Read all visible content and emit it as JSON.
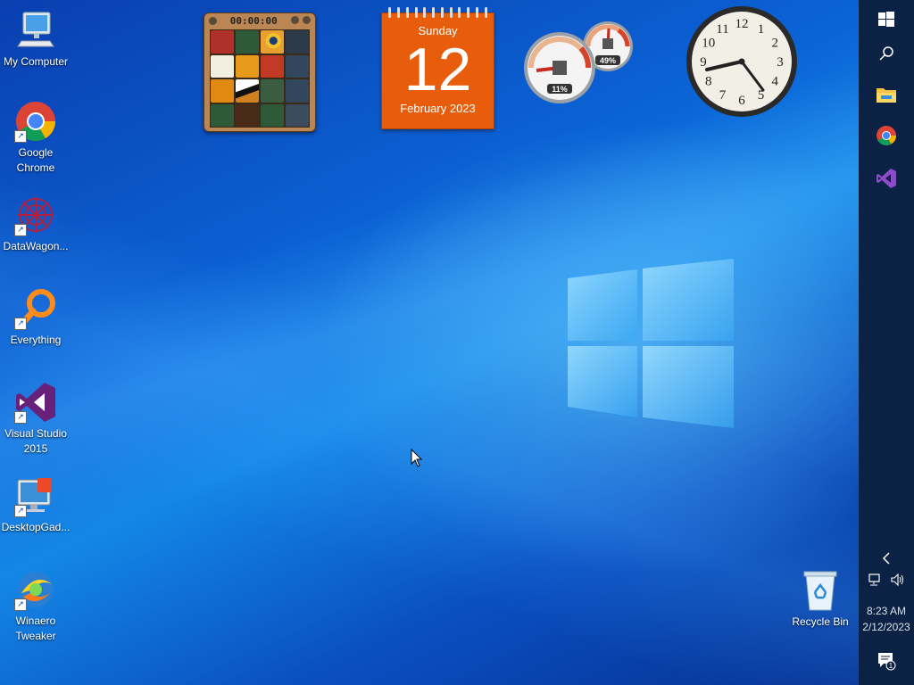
{
  "desktop": {
    "icons": [
      {
        "label": "My Computer"
      },
      {
        "label": "Google Chrome"
      },
      {
        "label": "DataWagon..."
      },
      {
        "label": "Everything"
      },
      {
        "label": "Visual Studio 2015"
      },
      {
        "label": "DesktopGad..."
      },
      {
        "label": "Winaero Tweaker"
      },
      {
        "label": "Recycle Bin"
      }
    ]
  },
  "gadgets": {
    "puzzle": {
      "timer": "00:00:00"
    },
    "calendar": {
      "day": "Sunday",
      "date": "12",
      "month": "February 2023"
    },
    "cpu_meter": {
      "cpu": "11%",
      "memory": "49%",
      "cpu_level": 0.11,
      "memory_level": 0.49
    },
    "clock": {
      "numbers": [
        "12",
        "1",
        "2",
        "3",
        "4",
        "5",
        "6",
        "7",
        "8",
        "9",
        "10",
        "11"
      ]
    }
  },
  "taskbar": {
    "pinned": [
      "start-icon",
      "search-icon",
      "file-explorer-icon",
      "chrome-icon",
      "visual-studio-icon"
    ],
    "tray": {
      "time": "8:23 AM",
      "date": "2/12/2023",
      "notification_count": "1"
    }
  },
  "colors": {
    "taskbar": "#0c2244",
    "calendar": "#e85d0c",
    "accent": "#1387e6"
  }
}
